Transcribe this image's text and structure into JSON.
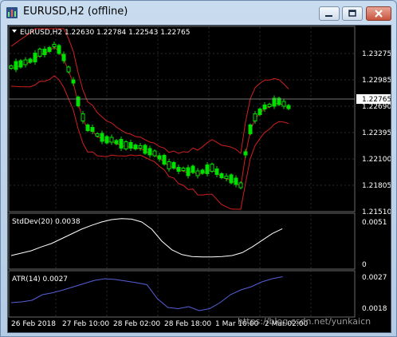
{
  "window": {
    "title": "EURUSD,H2 (offline)"
  },
  "main_panel": {
    "header": "EURUSD,H2  1.22630 1.22784 1.22543 1.22765",
    "price_labels": [
      "1.23275",
      "1.22985",
      "1.22690",
      "1.22395",
      "1.22100",
      "1.21805",
      "1.21510"
    ],
    "current_price": "1.22765"
  },
  "stddev_panel": {
    "header": "StdDev(20) 0.0038",
    "scale_labels": [
      "0.0051",
      "0"
    ]
  },
  "atr_panel": {
    "header": "ATR(14) 0.0027",
    "scale_labels": [
      "0.0027",
      "0.0018"
    ]
  },
  "time_axis": {
    "labels": [
      "26 Feb 2018",
      "27 Feb 10:00",
      "28 Feb 02:00",
      "28 Feb 18:00",
      "1 Mar 10:00",
      "2 Mar 02:00"
    ]
  },
  "watermark": "https://blog.csdn.net/yunkaicn",
  "colors": {
    "background": "#000000",
    "candle": "#00e000",
    "band": "#d02020",
    "stddev": "#ffffff",
    "atr": "#5560d8",
    "grid": "#3a3a3a",
    "text": "#ffffff"
  }
}
